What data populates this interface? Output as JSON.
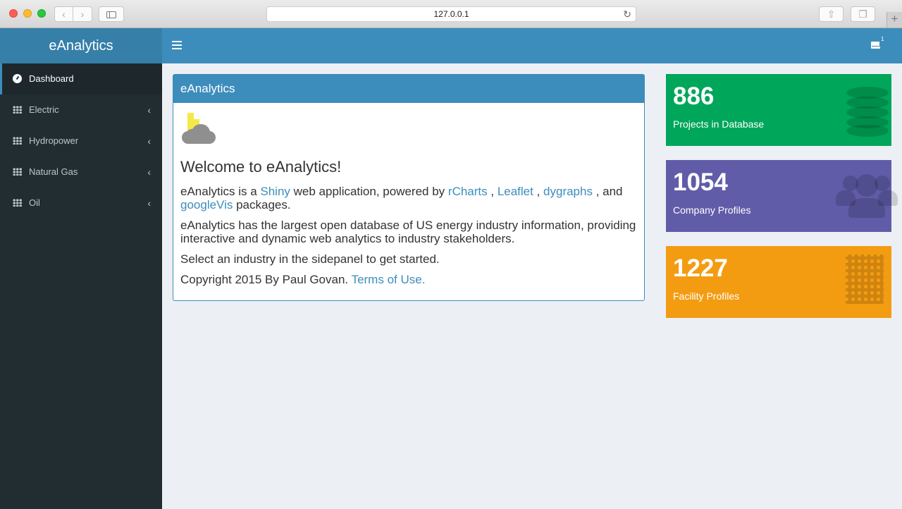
{
  "browser": {
    "url": "127.0.0.1"
  },
  "header": {
    "brand": "eAnalytics",
    "mail_badge": "1"
  },
  "sidebar": {
    "items": [
      {
        "label": "Dashboard",
        "icon": "dashboard-icon",
        "active": true
      },
      {
        "label": "Electric",
        "icon": "grid-icon"
      },
      {
        "label": "Hydropower",
        "icon": "grid-icon"
      },
      {
        "label": "Natural Gas",
        "icon": "grid-icon"
      },
      {
        "label": "Oil",
        "icon": "grid-icon"
      }
    ]
  },
  "main": {
    "box_title": "eAnalytics",
    "welcome": "Welcome to eAnalytics!",
    "p1": {
      "t1": "eAnalytics is a ",
      "link_shiny": "Shiny",
      "t2": " web application, powered by ",
      "link_rcharts": "rCharts",
      "t3": " , ",
      "link_leaflet": "Leaflet",
      "t4": " , ",
      "link_dygraphs": "dygraphs",
      "t5": " , and ",
      "link_googlevis": "googleVis",
      "t6": " packages."
    },
    "p2": "eAnalytics has the largest open database of US energy industry information, providing interactive and dynamic web analytics to industry stakeholders.",
    "p3": "Select an industry in the sidepanel to get started.",
    "p4": {
      "text": "Copyright 2015 By Paul Govan. ",
      "link_terms": "Terms of Use."
    }
  },
  "value_boxes": [
    {
      "value": "886",
      "label": "Projects in Database",
      "color": "#00a65a",
      "icon": "database-icon"
    },
    {
      "value": "1054",
      "label": "Company Profiles",
      "color": "#605ca8",
      "icon": "users-icon"
    },
    {
      "value": "1227",
      "label": "Facility Profiles",
      "color": "#f39c12",
      "icon": "building-icon"
    }
  ]
}
